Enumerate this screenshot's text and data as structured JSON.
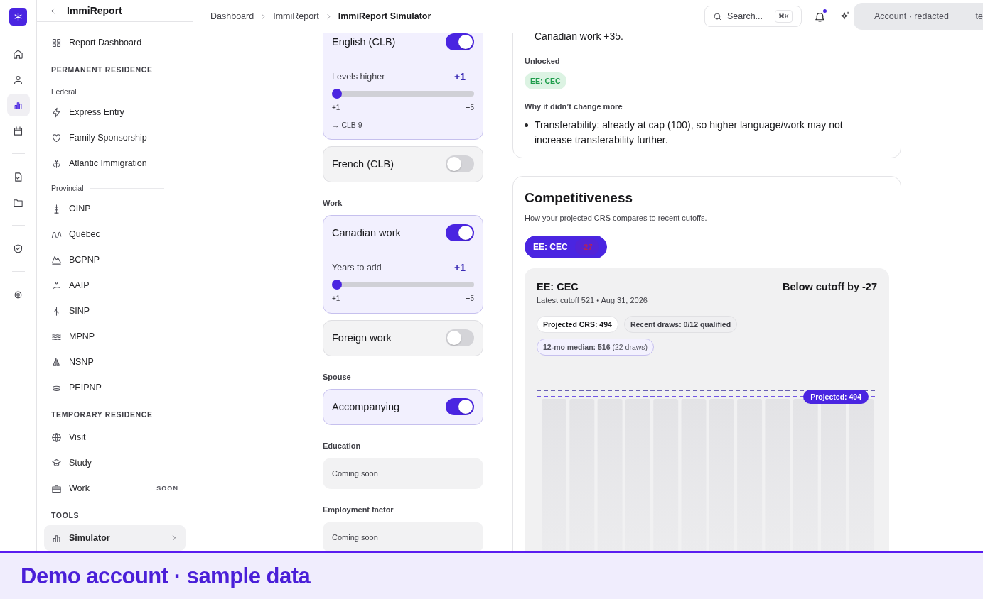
{
  "rail": [
    {
      "selected": false
    },
    {
      "selected": false
    },
    {
      "selected": true
    },
    {
      "selected": false
    },
    {
      "selected": false
    },
    {
      "selected": false
    },
    {
      "selected": false
    },
    {
      "selected": false
    }
  ],
  "sidebar": {
    "title": "ImmiReport",
    "top_item": {
      "label": "Report Dashboard",
      "selected": false
    },
    "sections": [
      {
        "heading": "PERMANENT RESIDENCE",
        "groups": [
          {
            "label": "Federal",
            "items": [
              {
                "label": "Express Entry",
                "selected": false
              },
              {
                "label": "Family Sponsorship",
                "selected": false
              },
              {
                "label": "Atlantic Immigration",
                "selected": false
              }
            ]
          },
          {
            "label": "Provincial",
            "items": [
              {
                "label": "OINP",
                "selected": false
              },
              {
                "label": "Québec",
                "selected": false
              },
              {
                "label": "BCPNP",
                "selected": false
              },
              {
                "label": "AAIP",
                "selected": false
              },
              {
                "label": "SINP",
                "selected": false
              },
              {
                "label": "MPNP",
                "selected": false
              },
              {
                "label": "NSNP",
                "selected": false
              },
              {
                "label": "PEIPNP",
                "selected": false
              }
            ]
          }
        ]
      },
      {
        "heading": "TEMPORARY RESIDENCE",
        "groups": [
          {
            "items": [
              {
                "label": "Visit",
                "selected": false
              },
              {
                "label": "Study",
                "selected": false
              },
              {
                "label": "Work",
                "selected": false,
                "badge": "SOON"
              }
            ]
          }
        ]
      },
      {
        "heading": "TOOLS",
        "groups": [
          {
            "items": [
              {
                "label": "Simulator",
                "selected": true
              }
            ]
          }
        ]
      }
    ]
  },
  "breadcrumb": [
    {
      "label": "Dashboard",
      "current": false
    },
    {
      "label": "ImmiReport",
      "current": false
    },
    {
      "label": "ImmiReport Simulator",
      "current": true
    }
  ],
  "search": {
    "placeholder": "Search...",
    "shortcut": "⌘K"
  },
  "notifications": {
    "unread": true
  },
  "account": {
    "label": "Account · redacted",
    "cut_text": "te"
  },
  "simulator": {
    "sections": [
      {
        "kind": "toggles",
        "toggles": [
          {
            "label": "English (CLB)",
            "on": true,
            "slider": {
              "label": "Levels higher",
              "value": "+1",
              "level": 0,
              "min": "+1",
              "max": "+5",
              "result": "→ CLB 9"
            }
          },
          {
            "label": "French (CLB)",
            "on": false
          }
        ]
      },
      {
        "kind": "toggles",
        "heading": "Work",
        "toggles": [
          {
            "label": "Canadian work",
            "on": true,
            "slider": {
              "label": "Years to add",
              "value": "+1",
              "level": 0,
              "min": "+1",
              "max": "+5"
            }
          },
          {
            "label": "Foreign work",
            "on": false
          }
        ]
      },
      {
        "kind": "toggles",
        "heading": "Spouse",
        "toggles": [
          {
            "label": "Accompanying",
            "on": true
          }
        ]
      },
      {
        "kind": "coming_soon",
        "heading": "Education",
        "note": "Coming soon"
      },
      {
        "kind": "coming_soon",
        "heading": "Employment factor",
        "note": "Coming soon"
      }
    ]
  },
  "impact": {
    "cut_text": "Canadian work +35.",
    "unlocked_label": "Unlocked",
    "unlocked": [
      {
        "label": "EE: CEC"
      }
    ],
    "why_label": "Why it didn’t change more",
    "reasons": [
      "Transferability: already at cap (100), so higher language/work may not increase transferability further."
    ]
  },
  "competitiveness": {
    "title": "Competitiveness",
    "subtitle": "How your projected CRS compares to recent cutoffs.",
    "programs": [
      {
        "label": "EE: CEC",
        "delta": "-27",
        "selected": true
      }
    ],
    "detail": {
      "program": "EE: CEC",
      "status": "Below cutoff by -27",
      "cutoff_line": "Latest cutoff 521 • Aug 31, 2026",
      "chips": [
        {
          "kind": "plain",
          "text": "Projected CRS: 494"
        },
        {
          "kind": "muted",
          "text": "Recent draws: 0/12 qualified"
        },
        {
          "kind": "accent",
          "text": "**12-mo median: 516** (22 draws)"
        }
      ],
      "projected_label": "Projected: 494"
    }
  },
  "banner": {
    "text": "Demo account · sample data"
  }
}
